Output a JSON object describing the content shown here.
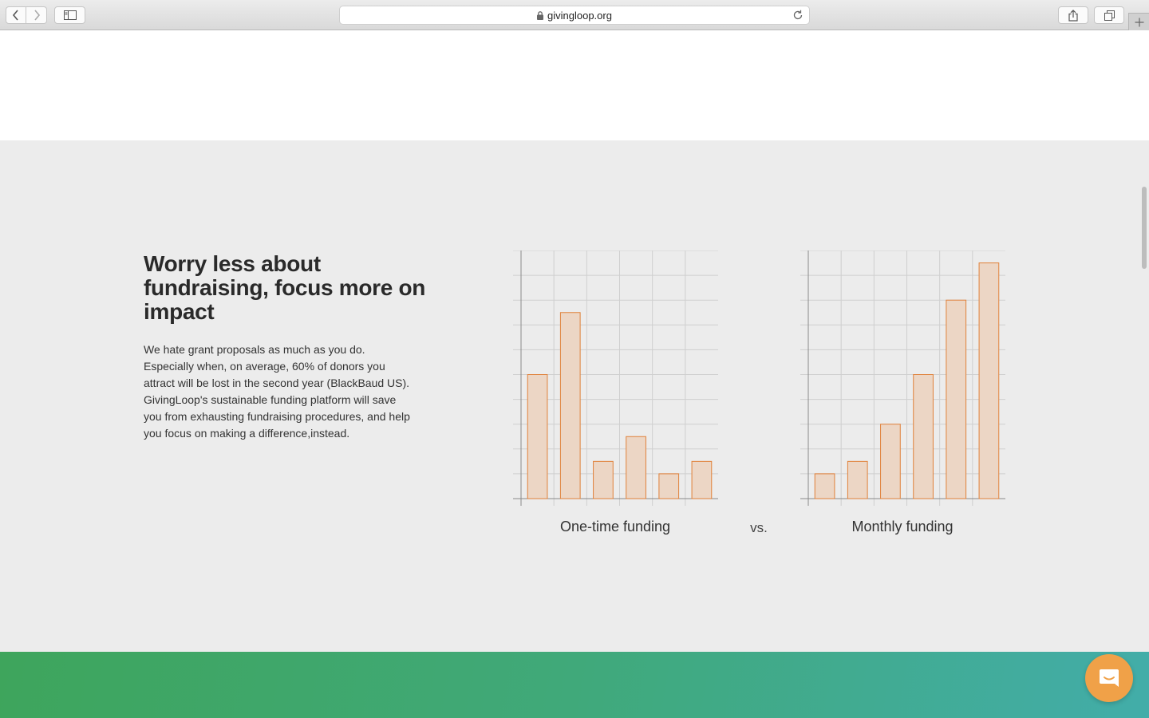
{
  "browser": {
    "url": "givingloop.org",
    "icons": [
      "back-icon",
      "forward-icon",
      "sidebar-icon",
      "lock-icon",
      "reload-icon",
      "share-icon",
      "tabs-icon",
      "plus-icon"
    ]
  },
  "section": {
    "headline": "Worry less about fundraising, focus more on impact",
    "body": "We hate grant proposals as much as you do. Especially when, on average, 60% of donors you attract will be lost in the second year (BlackBaud US). GivingLoop's sustainable funding platform will save you from exhausting fundraising procedures, and help you focus on making a difference,instead.",
    "vs": "vs."
  },
  "colors": {
    "bar_fill": "#ecd6c5",
    "bar_stroke": "#e0813a",
    "section_bg": "#ececec",
    "chat_button": "#f0a148"
  },
  "chart_data": [
    {
      "type": "bar",
      "title": "One-time funding",
      "categories": [
        "",
        "",
        "",
        "",
        "",
        ""
      ],
      "values": [
        5,
        7.5,
        1.5,
        2.5,
        1,
        1.5
      ],
      "ylim": [
        0,
        10
      ],
      "grid": true
    },
    {
      "type": "bar",
      "title": "Monthly funding",
      "categories": [
        "",
        "",
        "",
        "",
        "",
        ""
      ],
      "values": [
        1,
        1.5,
        3,
        5,
        8,
        9.5
      ],
      "ylim": [
        0,
        10
      ],
      "grid": true
    }
  ],
  "chat": {
    "icon": "chat-icon"
  }
}
